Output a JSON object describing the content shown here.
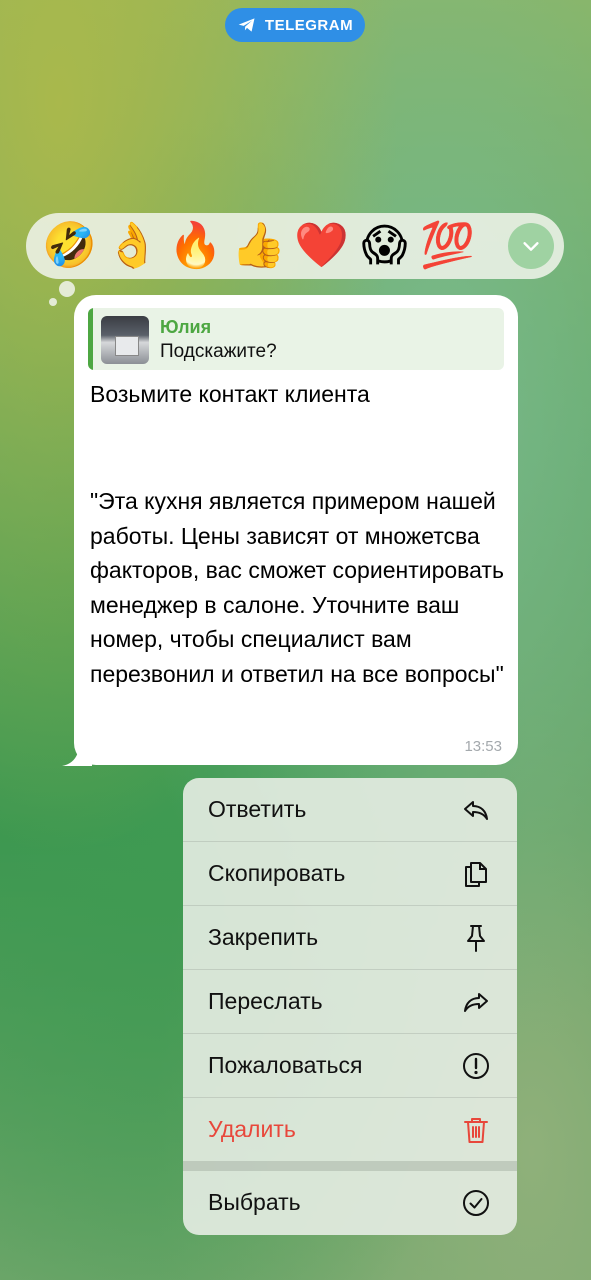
{
  "watermark": {
    "label": "TELEGRAM"
  },
  "reactions": {
    "items": [
      "🤣",
      "👌",
      "🔥",
      "👍",
      "❤️",
      "😱",
      "💯"
    ],
    "more_icon": "chevron-down-icon"
  },
  "message": {
    "reply": {
      "name": "Юлия",
      "text": "Подскажите?"
    },
    "line1": "Возьмите контакт клиента",
    "body": "\"Эта кухня является примером нашей работы. Цены зависят от множетсва факторов, вас сможет сориентировать менеджер в салоне. Уточните ваш номер, чтобы специалист вам перезвонил и ответил на все вопросы\"",
    "time": "13:53"
  },
  "menu": {
    "reply": {
      "label": "Ответить",
      "icon": "reply-icon"
    },
    "copy": {
      "label": "Скопировать",
      "icon": "copy-icon"
    },
    "pin": {
      "label": "Закрепить",
      "icon": "pin-icon"
    },
    "forward": {
      "label": "Переслать",
      "icon": "forward-icon"
    },
    "report": {
      "label": "Пожаловаться",
      "icon": "report-icon"
    },
    "delete": {
      "label": "Удалить",
      "icon": "trash-icon",
      "color": "#e8473b"
    },
    "select": {
      "label": "Выбрать",
      "icon": "check-circle-icon"
    }
  }
}
